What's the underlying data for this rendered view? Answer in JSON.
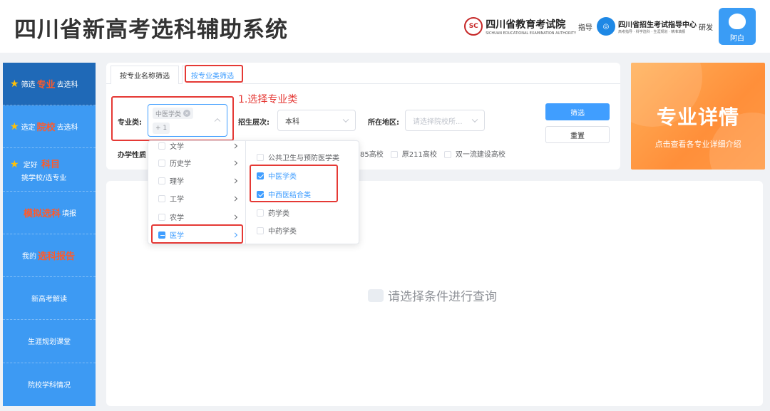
{
  "header": {
    "title": "四川省新高考选科辅助系统",
    "logo1_seal": "SC",
    "logo1_name": "四川省教育考试院",
    "logo1_en": "SICHUAN EDUCATIONAL EXAMINATION AUTHORITY",
    "guide_text": "指导",
    "logo2_name": "四川省招生考试指导中心",
    "logo2_sub": "高考指导 · 科学选科 · 生涯规划 · 精准填报",
    "dev_text": "研发",
    "user_name": "阿白"
  },
  "sidebar": {
    "items": [
      {
        "pre": "筛选",
        "hl": "专业",
        "post": "去选科"
      },
      {
        "pre": "选定",
        "hl": "院校",
        "post": "去选科"
      },
      {
        "pre": "定好",
        "hl": "科目",
        "line2": "挑学校/选专业"
      },
      {
        "hl": "模拟选科",
        "post": "填报"
      },
      {
        "pre": "我的",
        "hl": "选科报告"
      },
      {
        "label": "新高考解读"
      },
      {
        "label": "生涯规划课堂"
      },
      {
        "label": "院校学科情况"
      }
    ]
  },
  "filter": {
    "tab_name": "按专业名称筛选",
    "tab_category": "按专业类筛选",
    "annotation": "1.选择专业类",
    "major_class_label": "专业类:",
    "selected_tag": "中医学类",
    "more_tag": "+ 1",
    "level_label": "招生层次:",
    "level_value": "本科",
    "region_label": "所在地区:",
    "region_placeholder": "请选择院校所...",
    "school_type_label": "办学性质",
    "filter_button": "筛选",
    "reset_button": "重置",
    "school_tags": [
      "85高校",
      "原211高校",
      "双一流建设高校"
    ]
  },
  "dropdown": {
    "categories": [
      {
        "label": "文学",
        "state": "none"
      },
      {
        "label": "历史学",
        "state": "none"
      },
      {
        "label": "理学",
        "state": "none"
      },
      {
        "label": "工学",
        "state": "none"
      },
      {
        "label": "农学",
        "state": "none"
      },
      {
        "label": "医学",
        "state": "indeterminate"
      }
    ],
    "subcategories": [
      {
        "label": "公共卫生与预防医学类",
        "checked": false
      },
      {
        "label": "中医学类",
        "checked": true
      },
      {
        "label": "中西医结合类",
        "checked": true
      },
      {
        "label": "药学类",
        "checked": false
      },
      {
        "label": "中药学类",
        "checked": false
      }
    ]
  },
  "results": {
    "empty_text": "请选择条件进行查询"
  },
  "promo": {
    "title": "专业详情",
    "subtitle": "点击查看各专业详细介绍"
  },
  "colors": {
    "primary": "#409eff",
    "sidebar": "#3d9af3",
    "sidebar_active": "#1f69b7",
    "highlight": "#ff5a2a",
    "annotation": "#e53935",
    "promo": "#ff9a45"
  }
}
